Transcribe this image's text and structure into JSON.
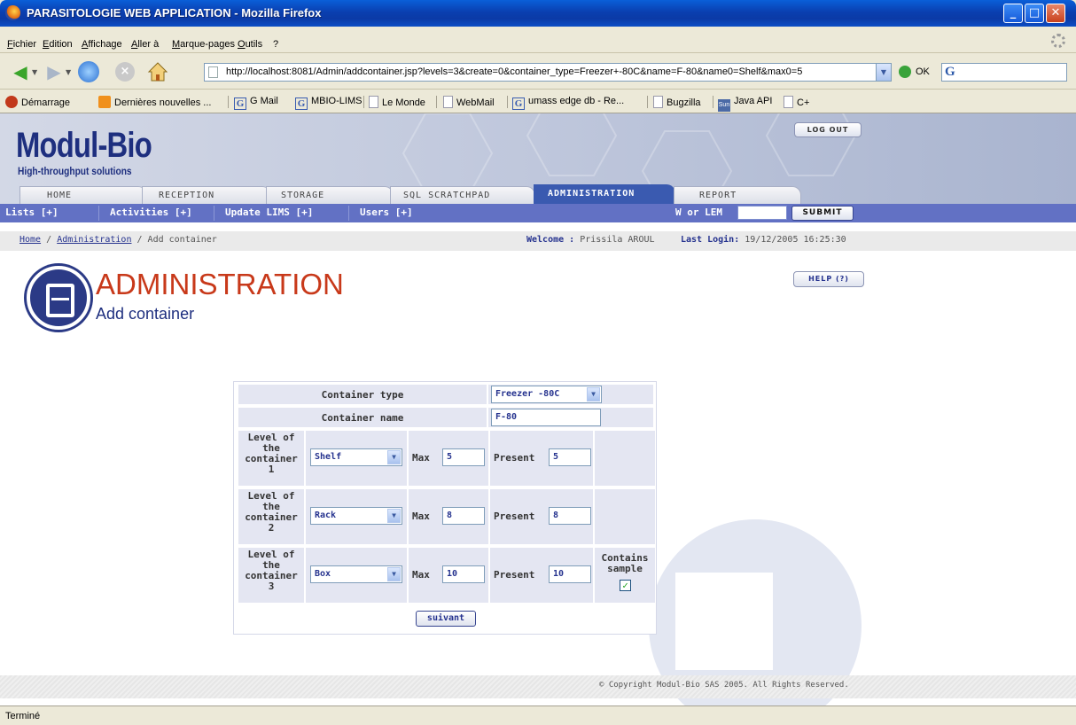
{
  "window": {
    "title": "PARASITOLOGIE WEB APPLICATION - Mozilla Firefox"
  },
  "menu": [
    "Fichier",
    "Edition",
    "Affichage",
    "Aller à",
    "Marque-pages",
    "Outils",
    "?"
  ],
  "nav": {
    "url": "http://localhost:8081/Admin/addcontainer.jsp?levels=3&create=0&container_type=Freezer+-80C&name=F-80&name0=Shelf&max0=5",
    "go_label": "OK"
  },
  "bookmarks": [
    "Démarrage",
    "Dernières nouvelles ...",
    "G Mail",
    "MBIO-LIMS",
    "Le Monde",
    "WebMail",
    "umass edge db - Re...",
    "Bugzilla",
    "Java API",
    "C+"
  ],
  "header": {
    "logo": "Modul-Bio",
    "tagline": "High-throughput solutions",
    "logout": "LOG OUT"
  },
  "tabs": [
    "HOME",
    "RECEPTION",
    "STORAGE",
    "SQL SCRATCHPAD",
    "ADMINISTRATION",
    "REPORT"
  ],
  "subnav": {
    "items": [
      "Lists [+]",
      "Activities [+]",
      "Update LIMS [+]",
      "Users [+]"
    ],
    "wlem_label": "W or LEM",
    "submit": "SUBMIT"
  },
  "breadcrumb": {
    "home": "Home",
    "admin": "Administration",
    "current": "/ Add container",
    "sep": "/",
    "welcome_label": "Welcome :",
    "welcome_user": "Prissila AROUL",
    "last_login_label": "Last Login:",
    "last_login": "19/12/2005 16:25:30"
  },
  "page": {
    "title": "ADMINISTRATION",
    "subtitle": "Add container",
    "help": "HELP (?)"
  },
  "form": {
    "type_label": "Container type",
    "type_value": "Freezer -80C",
    "name_label": "Container name",
    "name_value": "F-80",
    "max_label": "Max",
    "present_label": "Present",
    "levels": [
      {
        "label_lines": [
          "Level of",
          "the",
          "container",
          "1"
        ],
        "type": "Shelf",
        "max": "5",
        "present": "5"
      },
      {
        "label_lines": [
          "Level of",
          "the",
          "container",
          "2"
        ],
        "type": "Rack",
        "max": "8",
        "present": "8"
      },
      {
        "label_lines": [
          "Level of",
          "the",
          "container",
          "3"
        ],
        "type": "Box",
        "max": "10",
        "present": "10"
      }
    ],
    "contains_sample_label": [
      "Contains",
      "sample"
    ],
    "contains_sample_checked": true,
    "submit": "suivant"
  },
  "footer": {
    "copyright": "© Copyright Modul-Bio SAS 2005. All Rights Reserved."
  },
  "status": {
    "text": "Terminé"
  }
}
